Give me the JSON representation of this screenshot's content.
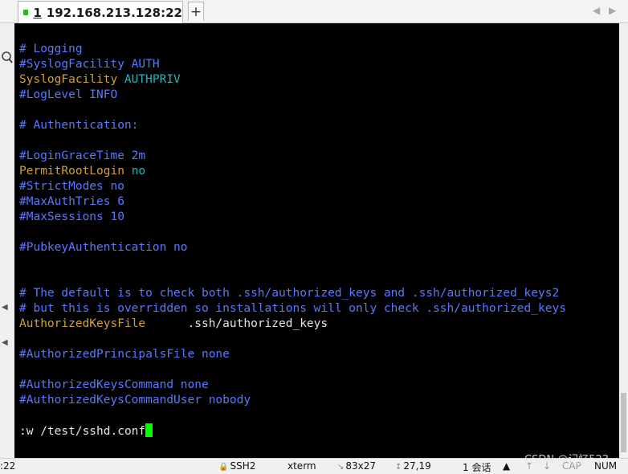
{
  "tab": {
    "number": "1",
    "title": "192.168.213.128:22",
    "close": "×",
    "add": "+"
  },
  "nav": {
    "prev": "◀",
    "next": "▶"
  },
  "terminal_lines": [
    [
      {
        "t": "# Logging",
        "c": "comment"
      }
    ],
    [
      {
        "t": "#SyslogFacility AUTH",
        "c": "comment"
      }
    ],
    [
      {
        "t": "SyslogFacility ",
        "c": "key"
      },
      {
        "t": "AUTHPRIV",
        "c": "val"
      }
    ],
    [
      {
        "t": "#LogLevel INFO",
        "c": "comment"
      }
    ],
    [],
    [
      {
        "t": "# Authentication:",
        "c": "comment"
      }
    ],
    [],
    [
      {
        "t": "#LoginGraceTime 2m",
        "c": "comment"
      }
    ],
    [
      {
        "t": "PermitRootLogin ",
        "c": "key"
      },
      {
        "t": "no",
        "c": "val"
      }
    ],
    [
      {
        "t": "#StrictModes no",
        "c": "comment"
      }
    ],
    [
      {
        "t": "#MaxAuthTries 6",
        "c": "comment"
      }
    ],
    [
      {
        "t": "#MaxSessions 10",
        "c": "comment"
      }
    ],
    [],
    [
      {
        "t": "#PubkeyAuthentication no",
        "c": "comment"
      }
    ],
    [],
    [],
    [
      {
        "t": "# The default is to check both .ssh/authorized_keys and .ssh/authorized_keys2",
        "c": "comment"
      }
    ],
    [
      {
        "t": "# but this is overridden so installations will only check .ssh/authorized_keys",
        "c": "comment"
      }
    ],
    [
      {
        "t": "AuthorizedKeysFile      ",
        "c": "key"
      },
      {
        "t": ".ssh/authorized_keys",
        "c": "plain"
      }
    ],
    [],
    [
      {
        "t": "#AuthorizedPrincipalsFile none",
        "c": "comment"
      }
    ],
    [],
    [
      {
        "t": "#AuthorizedKeysCommand none",
        "c": "comment"
      }
    ],
    [
      {
        "t": "#AuthorizedKeysCommandUser nobody",
        "c": "comment"
      }
    ],
    [],
    [
      {
        "t": ":w /test/sshd.conf",
        "c": "plain"
      }
    ]
  ],
  "status": {
    "left": ":22",
    "protocol": "SSH2",
    "terminal": "xterm",
    "size": "83x27",
    "position": "27,19",
    "sessions": "1 会话",
    "caps": "CAP",
    "num": "NUM"
  },
  "watermark": "CSDN @记忆523",
  "colors": {
    "comment": "#5a78ff",
    "keyword": "#d3a12a",
    "value": "#1fb7b7",
    "cursor": "#00ff00",
    "background": "#000000"
  }
}
